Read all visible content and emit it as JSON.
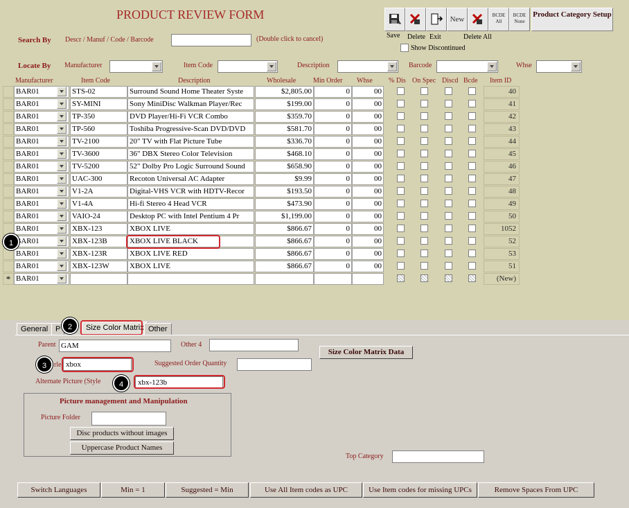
{
  "form": {
    "title": "PRODUCT REVIEW FORM"
  },
  "toolbar": {
    "new_label": "New",
    "bcde_all": "BCDE All",
    "bcde_none": "BCDE None",
    "product_category_setup": "Product Category Setup",
    "save": "Save",
    "delete": "Delete",
    "exit": "Exit",
    "delete_all": "Delete All",
    "show_discontinued": "Show Discontinued"
  },
  "search": {
    "label": "Search By",
    "fields_label": "Descr / Manuf / Code / Barcode",
    "value": "",
    "hint": "(Double click to cancel)"
  },
  "locate": {
    "label": "Locate By",
    "manufacturer": "Manufacturer",
    "item_code": "Item Code",
    "description": "Description",
    "barcode": "Barcode",
    "whse": "Whse"
  },
  "grid": {
    "columns": [
      "Manufacturer",
      "Item Code",
      "Description",
      "Wholesale",
      "Min Order",
      "Whse",
      "% Dis",
      "On Spec",
      "Discd",
      "Bcde",
      "Item ID"
    ],
    "rows": [
      {
        "manufacturer": "BAR01",
        "item_code": "STS-02",
        "description": "Surround Sound Home Theater Syste",
        "wholesale": "$2,805.00",
        "min_order": "0",
        "whse": "00",
        "item_id": "40"
      },
      {
        "manufacturer": "BAR01",
        "item_code": "SY-MINI",
        "description": "Sony MiniDisc Walkman Player/Rec",
        "wholesale": "$199.00",
        "min_order": "0",
        "whse": "00",
        "item_id": "41"
      },
      {
        "manufacturer": "BAR01",
        "item_code": "TP-350",
        "description": "DVD Player/Hi-Fi VCR Combo",
        "wholesale": "$359.70",
        "min_order": "0",
        "whse": "00",
        "item_id": "42"
      },
      {
        "manufacturer": "BAR01",
        "item_code": "TP-560",
        "description": "Toshiba Progressive-Scan DVD/DVD",
        "wholesale": "$581.70",
        "min_order": "0",
        "whse": "00",
        "item_id": "43"
      },
      {
        "manufacturer": "BAR01",
        "item_code": "TV-2100",
        "description": "20\" TV with Flat Picture Tube",
        "wholesale": "$336.70",
        "min_order": "0",
        "whse": "00",
        "item_id": "44"
      },
      {
        "manufacturer": "BAR01",
        "item_code": "TV-3600",
        "description": "36\" DBX Stereo Color Television",
        "wholesale": "$468.10",
        "min_order": "0",
        "whse": "00",
        "item_id": "45"
      },
      {
        "manufacturer": "BAR01",
        "item_code": "TV-5200",
        "description": "52\" Dolby Pro Logic Surround Sound",
        "wholesale": "$658.90",
        "min_order": "0",
        "whse": "00",
        "item_id": "46"
      },
      {
        "manufacturer": "BAR01",
        "item_code": "UAC-300",
        "description": "Recoton Universal AC Adapter",
        "wholesale": "$9.99",
        "min_order": "0",
        "whse": "00",
        "item_id": "47"
      },
      {
        "manufacturer": "BAR01",
        "item_code": "V1-2A",
        "description": "Digital-VHS VCR with HDTV-Recor",
        "wholesale": "$193.50",
        "min_order": "0",
        "whse": "00",
        "item_id": "48"
      },
      {
        "manufacturer": "BAR01",
        "item_code": "V1-4A",
        "description": "Hi-fi Stereo 4 Head VCR",
        "wholesale": "$473.90",
        "min_order": "0",
        "whse": "00",
        "item_id": "49"
      },
      {
        "manufacturer": "BAR01",
        "item_code": "VAIO-24",
        "description": "Desktop PC with Intel Pentium 4 Pr",
        "wholesale": "$1,199.00",
        "min_order": "0",
        "whse": "00",
        "item_id": "50"
      },
      {
        "manufacturer": "BAR01",
        "item_code": "XBX-123",
        "description": "XBOX LIVE",
        "wholesale": "$866.67",
        "min_order": "0",
        "whse": "00",
        "item_id": "1052"
      },
      {
        "manufacturer": "BAR01",
        "item_code": "XBX-123B",
        "description": "XBOX LIVE BLACK",
        "wholesale": "$866.67",
        "min_order": "0",
        "whse": "00",
        "item_id": "52"
      },
      {
        "manufacturer": "BAR01",
        "item_code": "XBX-123R",
        "description": "XBOX LIVE RED",
        "wholesale": "$866.67",
        "min_order": "0",
        "whse": "00",
        "item_id": "53"
      },
      {
        "manufacturer": "BAR01",
        "item_code": "XBX-123W",
        "description": "XBOX LIVE",
        "wholesale": "$866.67",
        "min_order": "0",
        "whse": "00",
        "item_id": "51"
      }
    ],
    "new_row": {
      "marker": "*",
      "manufacturer": "BAR01",
      "item_id": "(New)"
    }
  },
  "tabs": [
    "General",
    "P",
    "Size Color Matrix",
    "Other"
  ],
  "detail": {
    "parent_label": "Parent",
    "parent_value": "GAM",
    "other4_label": "Other 4",
    "other4_value": "",
    "style_label": "rle",
    "style_value": "xbox",
    "suggested_label": "Suggested Order Quantity",
    "suggested_value": "",
    "alt_picture_label": "Alternate Picture (Style",
    "alt_picture_value": "xbx-123b",
    "scm_data_button": "Size Color Matrix Data",
    "picture_group_title": "Picture management and Manipulation",
    "picture_folder_label": "Picture Folder",
    "picture_folder_value": "",
    "disc_button": "Disc products without images",
    "uppercase_button": "Uppercase Product Names",
    "top_category_label": "Top Category",
    "top_category_value": ""
  },
  "footer": [
    "Switch Languages",
    "Min = 1",
    "Suggested = Min",
    "Use All Item codes as UPC",
    "Use Item codes for missing UPCs",
    "Remove Spaces From UPC"
  ],
  "callouts": [
    "1",
    "2",
    "3",
    "4"
  ],
  "colors": {
    "title": "#A52A2A",
    "label": "#8B1A1A",
    "panel": "#D6D3B2",
    "callout": "#D0282E"
  }
}
